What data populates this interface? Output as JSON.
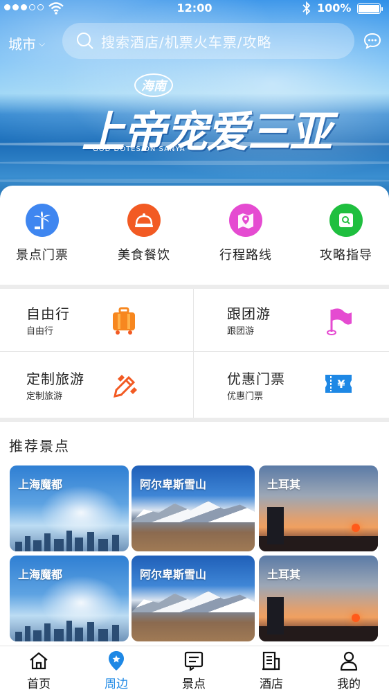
{
  "status_bar": {
    "time": "12:00",
    "battery": "100%"
  },
  "header": {
    "city": "城市",
    "search_placeholder": "搜索酒店/机票火车票/攻略"
  },
  "banner": {
    "tag": "海南",
    "title": "上帝宠爱三亚",
    "subtitle": "GOD DOTES ON SANYA"
  },
  "quick_entries": [
    {
      "label": "景点门票",
      "icon": "palm-tree-icon",
      "color": "#3f86f0"
    },
    {
      "label": "美食餐饮",
      "icon": "food-dome-icon",
      "color": "#f25a23"
    },
    {
      "label": "行程路线",
      "icon": "map-pin-icon",
      "color": "#e54bd1"
    },
    {
      "label": "攻略指导",
      "icon": "guide-map-icon",
      "color": "#1fbf3f"
    }
  ],
  "services": [
    {
      "title": "自由行",
      "subtitle": "自由行",
      "icon": "luggage-icon"
    },
    {
      "title": "跟团游",
      "subtitle": "跟团游",
      "icon": "flag-icon"
    },
    {
      "title": "定制旅游",
      "subtitle": "定制旅游",
      "icon": "pencil-icon"
    },
    {
      "title": "优惠门票",
      "subtitle": "优惠门票",
      "icon": "ticket-icon"
    }
  ],
  "recommended": {
    "title": "推荐景点",
    "items": [
      {
        "name": "上海魔都"
      },
      {
        "name": "阿尔卑斯雪山"
      },
      {
        "name": "土耳其"
      },
      {
        "name": "上海魔都"
      },
      {
        "name": "阿尔卑斯雪山"
      },
      {
        "name": "土耳其"
      }
    ]
  },
  "tab_bar": {
    "active": "周边",
    "tabs": [
      {
        "label": "首页",
        "icon": "home-icon"
      },
      {
        "label": "周边",
        "icon": "location-icon"
      },
      {
        "label": "景点",
        "icon": "attraction-icon"
      },
      {
        "label": "酒店",
        "icon": "hotel-icon"
      },
      {
        "label": "我的",
        "icon": "user-icon"
      }
    ]
  },
  "colors": {
    "accent": "#1e88e5",
    "divider": "#ececec"
  }
}
